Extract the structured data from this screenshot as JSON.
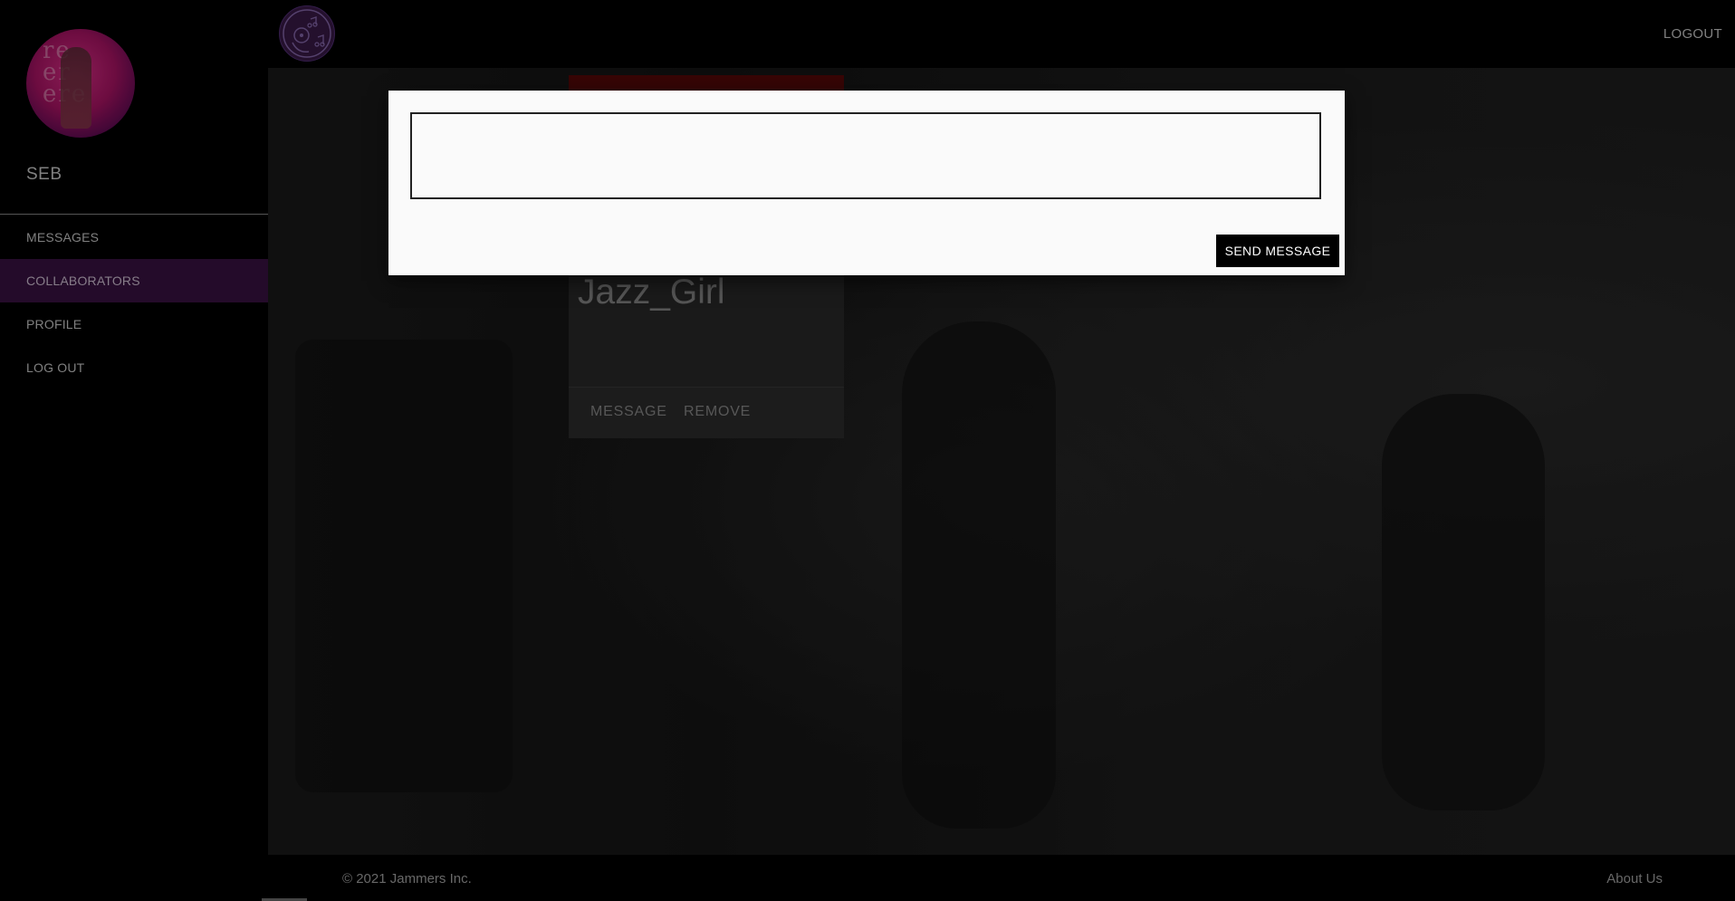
{
  "sidebar": {
    "user_name": "SEB",
    "avatar_text": "re re er",
    "nav": [
      {
        "label": "MESSAGES"
      },
      {
        "label": "COLLABORATORS"
      },
      {
        "label": "PROFILE"
      },
      {
        "label": "LOG OUT"
      }
    ]
  },
  "header": {
    "logo_icon": "music-note-disc-icon",
    "logout_label": "LOGOUT"
  },
  "card": {
    "name": "Jazz_Girl",
    "message_label": "MESSAGE",
    "remove_label": "REMOVE"
  },
  "modal": {
    "message_value": "",
    "send_label": "SEND MESSAGE"
  },
  "footer": {
    "copyright": "© 2021 Jammers Inc.",
    "about": "About Us"
  },
  "colors": {
    "accent": "#3a1245",
    "background": "#000000",
    "modal_bg": "#fafafa"
  }
}
